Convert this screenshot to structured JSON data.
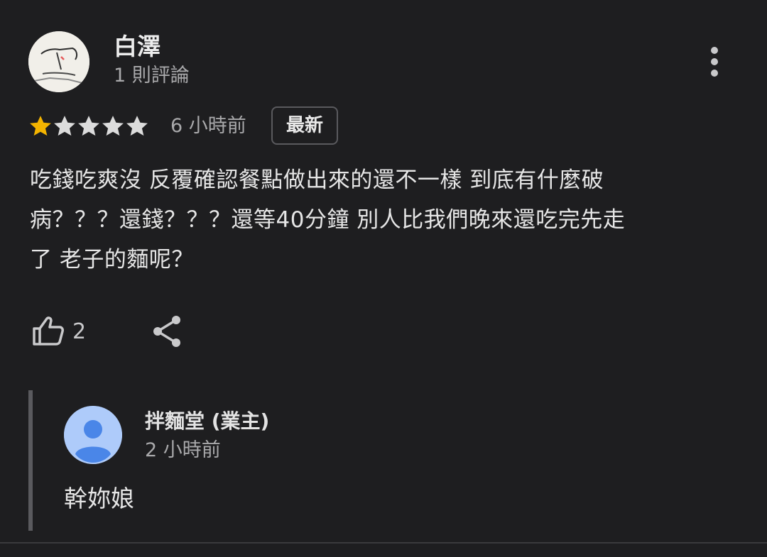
{
  "reviewer": {
    "name": "白澤",
    "review_count": "1 則評論"
  },
  "rating": {
    "value": 1,
    "max": 5,
    "filled_color": "#f4b400",
    "empty_color": "#dcdcdc"
  },
  "time_ago": "6 小時前",
  "badge": "最新",
  "review_text": "吃錢吃爽沒 反覆確認餐點做出來的還不一樣 到底有什麼破\n病？？？還錢？？？還等40分鐘 別人比我們晚來還吃完先走\n了 老子的麵呢？",
  "actions": {
    "like_count": "2",
    "like_icon": "thumb-up-icon",
    "share_icon": "share-icon",
    "more_icon": "more-vert-icon"
  },
  "owner_reply": {
    "name": "拌麵堂 (業主)",
    "time_ago": "2 小時前",
    "text": "幹妳娘",
    "avatar_color": "#aecbfa",
    "avatar_figure_color": "#4a86e8"
  }
}
